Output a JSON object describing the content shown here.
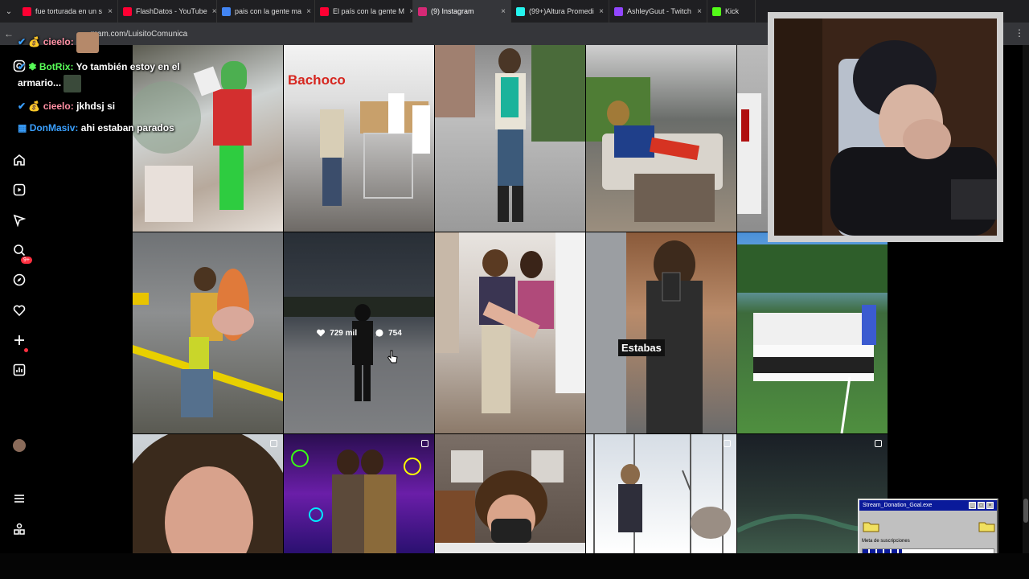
{
  "browser": {
    "tabs": [
      {
        "label": "fue torturada en un s",
        "color": "#ff0033"
      },
      {
        "label": "FlashDatos - YouTube",
        "color": "#ff0033"
      },
      {
        "label": "pais con la gente ma",
        "color": "#4285f4"
      },
      {
        "label": "El país con la gente M",
        "color": "#ff0033"
      },
      {
        "label": "(9) Instagram",
        "color": "#d62976"
      },
      {
        "label": "(99+)Altura Promedi",
        "color": "#25f4ee"
      },
      {
        "label": "AshleyGuut - Twitch",
        "color": "#9146ff"
      },
      {
        "label": "Kick",
        "color": "#53fc18"
      }
    ],
    "url": "gram.com/LuisitoComunica"
  },
  "chat": [
    {
      "user": "cieelo:",
      "message": "",
      "user_color": "#ff8fa3"
    },
    {
      "user": "BotRix:",
      "message": "Yo también estoy en el armario...",
      "user_color": "#59ff59"
    },
    {
      "user": "cieelo:",
      "message": "jkhdsj si",
      "user_color": "#ff8fa3"
    },
    {
      "user": "DonMasiv:",
      "message": "ahi estaban parados",
      "user_color": "#3aa0ff"
    }
  ],
  "hover_post": {
    "likes": "729 mil",
    "comments": "754"
  },
  "post_texts": {
    "bachoco": "Bachoco",
    "estabas": "Estabas"
  },
  "donation": {
    "title": "Stream_Donation_Goal.exe",
    "label": "Meta de suscripciones",
    "progress": 0.3
  }
}
